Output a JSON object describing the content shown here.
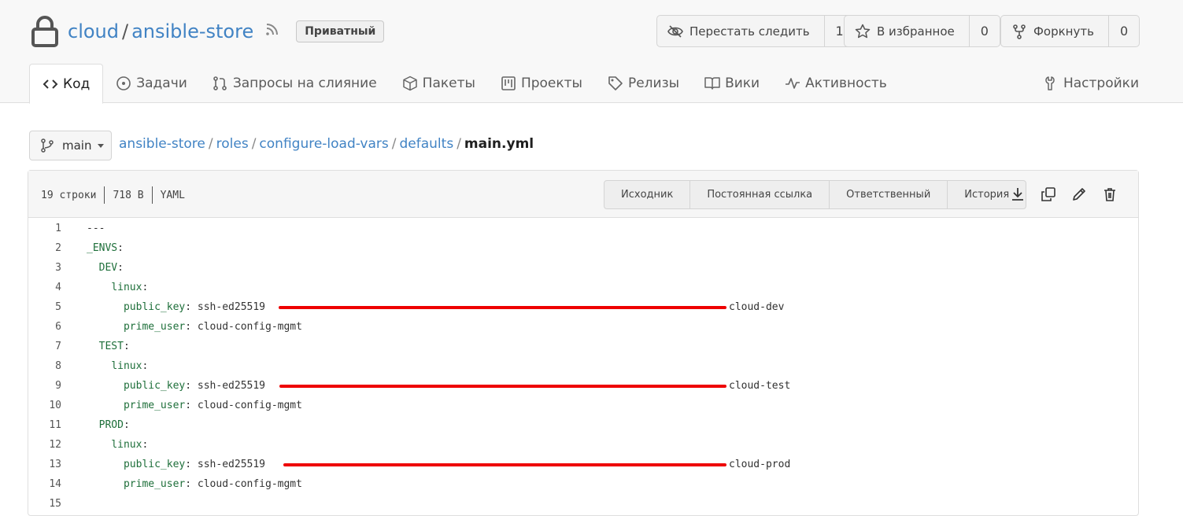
{
  "repo": {
    "owner": "cloud",
    "separator": "/",
    "name": "ansible-store",
    "visibility_badge": "Приватный"
  },
  "actions": {
    "watch": {
      "label": "Перестать следить",
      "count": "1"
    },
    "star": {
      "label": "В избранное",
      "count": "0"
    },
    "fork": {
      "label": "Форкнуть",
      "count": "0"
    }
  },
  "tabs": [
    {
      "label": "Код",
      "icon": "code-icon",
      "active": true
    },
    {
      "label": "Задачи",
      "icon": "issue-icon"
    },
    {
      "label": "Запросы на слияние",
      "icon": "pull-request-icon"
    },
    {
      "label": "Пакеты",
      "icon": "package-icon"
    },
    {
      "label": "Проекты",
      "icon": "project-icon"
    },
    {
      "label": "Релизы",
      "icon": "tag-icon"
    },
    {
      "label": "Вики",
      "icon": "book-icon"
    },
    {
      "label": "Активность",
      "icon": "pulse-icon"
    }
  ],
  "settings_tab": {
    "label": "Настройки",
    "icon": "tools-icon"
  },
  "branch": {
    "name": "main"
  },
  "breadcrumb": {
    "parts": [
      "ansible-store",
      "roles",
      "configure-load-vars",
      "defaults"
    ],
    "current": "main.yml",
    "separator": "/"
  },
  "file": {
    "lines_count": "19 строки",
    "size": "718 B",
    "language": "YAML",
    "buttons": [
      "Исходник",
      "Постоянная ссылка",
      "Ответственный",
      "История"
    ],
    "icons": [
      "download-icon",
      "copy-icon",
      "edit-icon",
      "trash-icon"
    ]
  },
  "code_lines": [
    {
      "n": "1",
      "indent": "",
      "key": "",
      "text": "---"
    },
    {
      "n": "2",
      "indent": "",
      "key": "_ENVS",
      "text": ":"
    },
    {
      "n": "3",
      "indent": "  ",
      "key": "DEV",
      "text": ":"
    },
    {
      "n": "4",
      "indent": "    ",
      "key": "linux",
      "text": ":"
    },
    {
      "n": "5",
      "indent": "      ",
      "key": "public_key",
      "text": ": ssh-ed25519",
      "suffix": "cloud-dev",
      "redacted": true
    },
    {
      "n": "6",
      "indent": "      ",
      "key": "prime_user",
      "text": ": cloud-config-mgmt"
    },
    {
      "n": "7",
      "indent": "  ",
      "key": "TEST",
      "text": ":"
    },
    {
      "n": "8",
      "indent": "    ",
      "key": "linux",
      "text": ":"
    },
    {
      "n": "9",
      "indent": "      ",
      "key": "public_key",
      "text": ": ssh-ed25519",
      "suffix": "cloud-test",
      "redacted": true
    },
    {
      "n": "10",
      "indent": "      ",
      "key": "prime_user",
      "text": ": cloud-config-mgmt"
    },
    {
      "n": "11",
      "indent": "  ",
      "key": "PROD",
      "text": ":"
    },
    {
      "n": "12",
      "indent": "    ",
      "key": "linux",
      "text": ":"
    },
    {
      "n": "13",
      "indent": "      ",
      "key": "public_key",
      "text": ": ssh-ed25519",
      "suffix": "cloud-prod",
      "redacted": true
    },
    {
      "n": "14",
      "indent": "      ",
      "key": "prime_user",
      "text": ": cloud-config-mgmt"
    },
    {
      "n": "15",
      "indent": "",
      "key": "",
      "text": ""
    }
  ],
  "colors": {
    "link": "#4183c4",
    "yaml_key": "#1e6f3a",
    "redaction": "#ee0000"
  }
}
